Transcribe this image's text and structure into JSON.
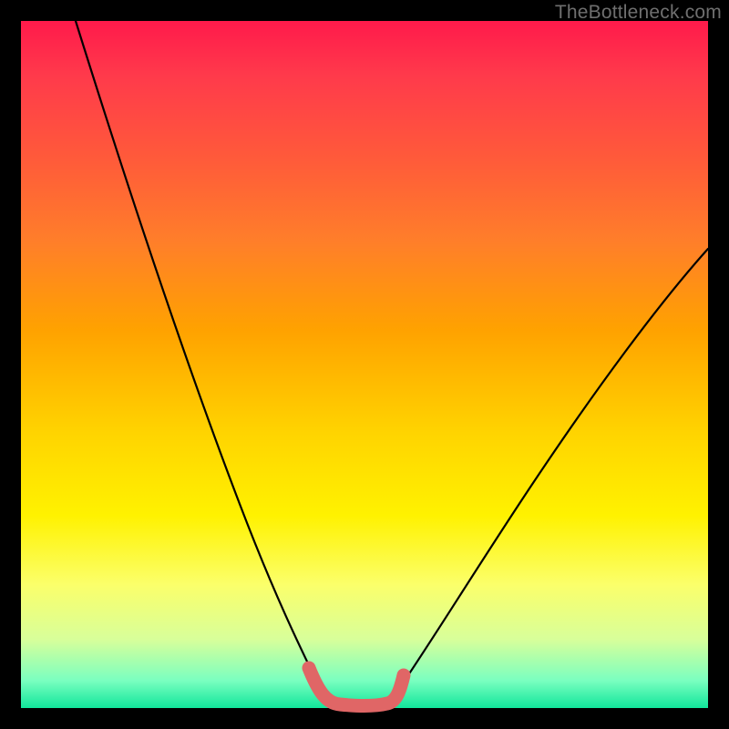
{
  "watermark": "TheBottleneck.com",
  "chart_data": {
    "type": "line",
    "title": "",
    "xlabel": "",
    "ylabel": "",
    "xlim": [
      0,
      100
    ],
    "ylim": [
      0,
      100
    ],
    "grid": false,
    "series": [
      {
        "name": "left-curve",
        "color": "#000000",
        "x": [
          8,
          12,
          16,
          20,
          24,
          28,
          32,
          36,
          40,
          42,
          44
        ],
        "y": [
          100,
          86,
          72,
          59,
          47,
          36,
          26,
          17,
          9,
          5,
          2
        ]
      },
      {
        "name": "right-curve",
        "color": "#000000",
        "x": [
          54,
          58,
          62,
          66,
          70,
          74,
          78,
          82,
          86,
          90,
          94,
          98,
          100
        ],
        "y": [
          2,
          6,
          11,
          16,
          22,
          28,
          34,
          40,
          46,
          52,
          58,
          64,
          67
        ]
      },
      {
        "name": "bottom-bridge",
        "color": "#e06666",
        "x": [
          42,
          44,
          46,
          48,
          50,
          52,
          54,
          55
        ],
        "y": [
          6,
          2,
          0.5,
          0.3,
          0.3,
          0.5,
          1.5,
          4
        ]
      }
    ],
    "gradient_stops": [
      {
        "pos": 0,
        "color": "#ff1a4b"
      },
      {
        "pos": 8,
        "color": "#ff3a4b"
      },
      {
        "pos": 20,
        "color": "#ff5a3a"
      },
      {
        "pos": 32,
        "color": "#ff7e2a"
      },
      {
        "pos": 45,
        "color": "#ffa200"
      },
      {
        "pos": 60,
        "color": "#ffd400"
      },
      {
        "pos": 72,
        "color": "#fff200"
      },
      {
        "pos": 82,
        "color": "#fbff6a"
      },
      {
        "pos": 90,
        "color": "#d8ff9a"
      },
      {
        "pos": 96,
        "color": "#7affc0"
      },
      {
        "pos": 100,
        "color": "#11e69b"
      }
    ]
  }
}
